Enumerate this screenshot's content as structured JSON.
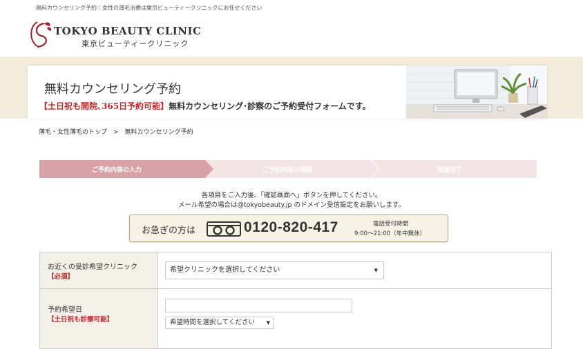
{
  "header": {
    "tagline": "無料カウンセリング予約｜女性の薄毛治療は東京ビューティークリニックにお任せください",
    "logo_en": "Tokyo Beauty Clinic",
    "logo_jp": "東京ビューティークリニック"
  },
  "hero": {
    "title": "無料カウンセリング予約",
    "sub_highlight": "【土日祝も開院､365日予約可能】",
    "sub_text": "無料カウンセリング･診察のご予約受付フォームです。"
  },
  "breadcrumb": {
    "home": "薄毛・女性薄毛のトップ",
    "separator": ">",
    "current": "無料カウンセリング予約"
  },
  "steps": [
    {
      "label": "ご予約内容の入力",
      "active": true
    },
    {
      "label": "ご予約内容の確認",
      "active": false
    },
    {
      "label": "送信完了",
      "active": false
    }
  ],
  "instructions": {
    "line1": "各項目をご入力後、「確認画面へ」ボタンを押してください。",
    "line2": "メール希望の場合は@tokyobeauty.jp のドメイン受信設定をお願いします。"
  },
  "phone": {
    "lead": "お急ぎの方は",
    "number": "0120-820-417",
    "hours_title": "電話受付時間",
    "hours": "9:00〜21:00（年中無休）"
  },
  "form": {
    "clinic": {
      "label": "お近くの受診希望クリニック",
      "required": "【必須】",
      "placeholder": "希望クリニックを選択してください"
    },
    "date": {
      "label": "予約希望日",
      "note": "【土日祝も診療可能】",
      "time_placeholder": "希望時間を選択してください"
    }
  },
  "colors": {
    "accent_red": "#c0282a",
    "step_active": "#d7a3a7",
    "step_inactive": "#f3e4e5",
    "hero_band": "#f3ecdc"
  }
}
